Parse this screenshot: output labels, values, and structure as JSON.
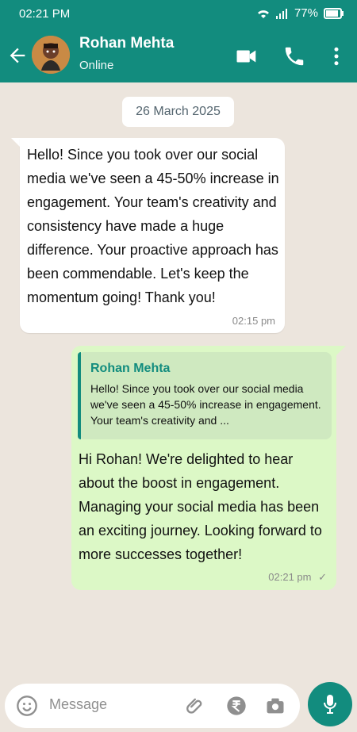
{
  "status_bar": {
    "time": "02:21 PM",
    "battery": "77%"
  },
  "header": {
    "name": "Rohan Mehta",
    "status": "Online"
  },
  "chat": {
    "date": "26 March 2025",
    "incoming": {
      "text": " Hello! Since you took over our social media we've seen a 45-50% increase in engagement. Your team's creativity and consistency have made a huge difference. Your proactive approach has been commendable. Let's keep the momentum going! Thank you!",
      "time": "02:15 pm"
    },
    "outgoing": {
      "quoted_name": "Rohan Mehta",
      "quoted_text": "Hello! Since you took over our social media we've seen a 45-50% increase in engagement. Your team's creativity and ...",
      "text": " Hi Rohan! We're delighted to hear about the boost in engagement. Managing your social media has been an exciting journey. Looking forward to more successes together!",
      "time": "02:21 pm"
    }
  },
  "composer": {
    "placeholder": "Message"
  },
  "colors": {
    "brand": "#128c7e",
    "outgoing_bubble": "#dcf8c6",
    "background": "#ece5dd"
  }
}
